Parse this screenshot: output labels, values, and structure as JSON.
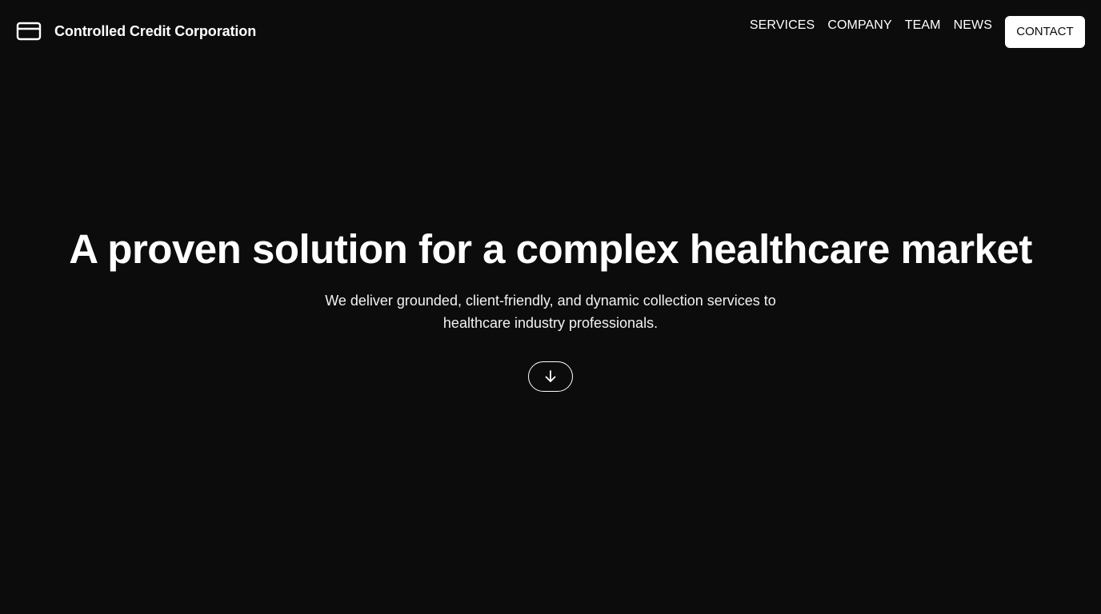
{
  "brand": {
    "name": "Controlled Credit Corporation",
    "icon": "credit-card-icon"
  },
  "nav": {
    "items": [
      {
        "label": "SERVICES"
      },
      {
        "label": "COMPANY"
      },
      {
        "label": "TEAM"
      },
      {
        "label": "NEWS"
      }
    ],
    "contact_label": "CONTACT"
  },
  "hero": {
    "title": "A proven solution for a complex healthcare market",
    "subtitle": "We deliver grounded, client-friendly, and dynamic collection services to healthcare industry professionals.",
    "scroll_icon": "arrow-down-icon"
  },
  "colors": {
    "background": "#0c0c0c",
    "text": "#ffffff",
    "button_bg": "#ffffff",
    "button_text": "#0c0c0c"
  }
}
